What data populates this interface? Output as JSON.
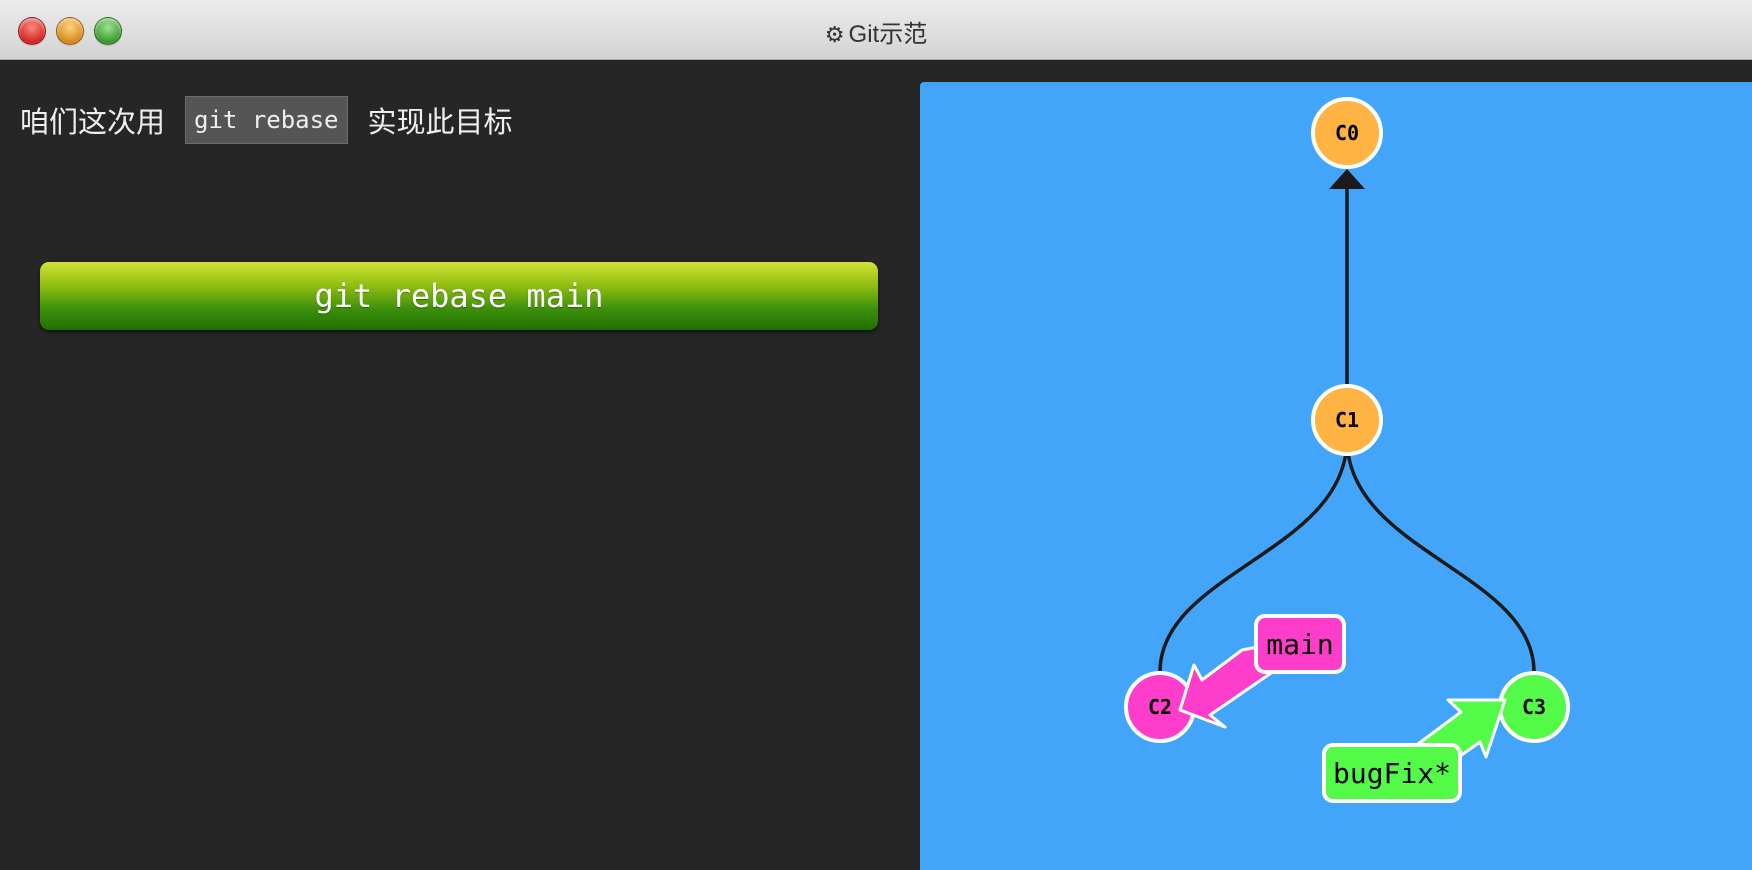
{
  "window": {
    "title": "Git示范",
    "gear_icon": "⚙"
  },
  "instruction": {
    "before": "咱们这次用",
    "code": "git rebase",
    "after": "实现此目标"
  },
  "command_button": {
    "label": "git rebase main"
  },
  "graph": {
    "background": "#42a5fa",
    "commits": [
      {
        "id": "C0",
        "label": "C0",
        "color": "#ffb343"
      },
      {
        "id": "C1",
        "label": "C1",
        "color": "#ffb343"
      },
      {
        "id": "C2",
        "label": "C2",
        "color": "#ff3dcb"
      },
      {
        "id": "C3",
        "label": "C3",
        "color": "#53fa48"
      }
    ],
    "branches": [
      {
        "name": "main",
        "label": "main",
        "target": "C2",
        "color": "#ff3dcb"
      },
      {
        "name": "bugFix",
        "label": "bugFix*",
        "target": "C3",
        "color": "#53fa48",
        "checked_out": true
      }
    ]
  }
}
